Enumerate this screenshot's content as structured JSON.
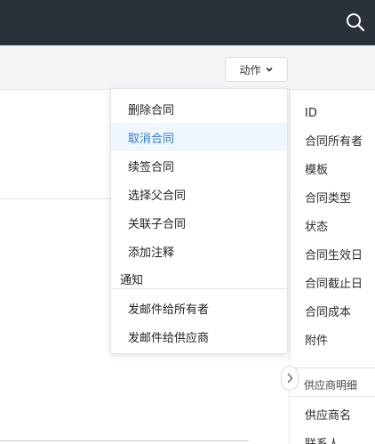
{
  "header": {
    "search_icon": "search-icon"
  },
  "toolbar": {
    "action_label": "动作",
    "action_icon": "chevron-down-icon"
  },
  "menu": {
    "items": [
      {
        "label": "删除合同"
      },
      {
        "label": "取消合同",
        "highlighted": true
      },
      {
        "label": "续签合同"
      },
      {
        "label": "选择父合同"
      },
      {
        "label": "关联子合同"
      },
      {
        "label": "添加注释"
      }
    ],
    "group_label": "通知",
    "notify_items": [
      {
        "label": "发邮件给所有者"
      },
      {
        "label": "发邮件给供应商"
      }
    ]
  },
  "fields": [
    "ID",
    "合同所有者",
    "模板",
    "合同类型",
    "状态",
    "合同生效日",
    "合同截止日",
    "合同成本",
    "附件"
  ],
  "supplier_section": {
    "title": "供应商明细",
    "fields": [
      "供应商名",
      "联系人"
    ]
  },
  "collapse_icon": "chevron-right-icon",
  "colors": {
    "topbar": "#2a3139",
    "accent": "#2d7bd6",
    "highlight_bg": "#f0f6fd"
  }
}
